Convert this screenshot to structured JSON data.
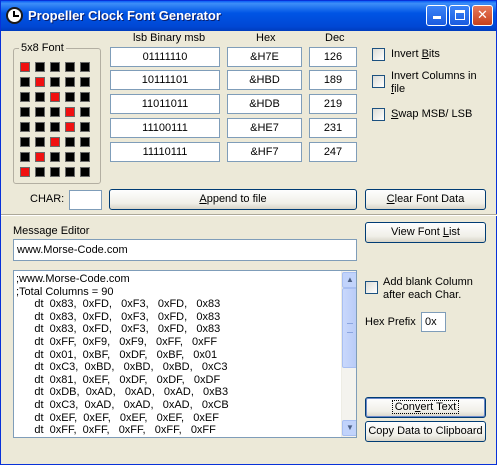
{
  "window": {
    "title": "Propeller Clock Font Generator",
    "accent": "#0055e5"
  },
  "font_editor": {
    "group_label": "5x8 Font",
    "grid": [
      [
        1,
        0,
        0,
        0,
        0
      ],
      [
        0,
        1,
        0,
        0,
        0
      ],
      [
        0,
        0,
        1,
        0,
        0
      ],
      [
        0,
        0,
        0,
        1,
        0
      ],
      [
        0,
        0,
        0,
        1,
        0
      ],
      [
        0,
        0,
        1,
        0,
        0
      ],
      [
        0,
        1,
        0,
        0,
        0
      ],
      [
        1,
        0,
        0,
        0,
        0
      ]
    ],
    "on_color": "#f01010",
    "off_color": "#000000",
    "headers": {
      "binary": "lsb  Binary  msb",
      "hex": "Hex",
      "dec": "Dec"
    },
    "rows": [
      {
        "binary": "01111110",
        "hex": "&H7E",
        "dec": "126"
      },
      {
        "binary": "10111101",
        "hex": "&HBD",
        "dec": "189"
      },
      {
        "binary": "11011011",
        "hex": "&HDB",
        "dec": "219"
      },
      {
        "binary": "11100111",
        "hex": "&HE7",
        "dec": "231"
      },
      {
        "binary": "11110111",
        "hex": "&HF7",
        "dec": "247"
      }
    ],
    "options": {
      "invert_bits": {
        "label_pre": "Invert ",
        "label_ul": "B",
        "label_post": "its"
      },
      "invert_columns": {
        "label_pre": "Invert Columns in ",
        "label_ul": "f",
        "label_post": "ile"
      },
      "swap": {
        "label_pre": "",
        "label_ul": "S",
        "label_post": "wap MSB/ LSB"
      }
    },
    "char_label": "CHAR:",
    "char_value": "",
    "append_button": {
      "pre": "",
      "ul": "A",
      "post": "ppend to file"
    },
    "clear_button": {
      "pre": "",
      "ul": "C",
      "post": "lear Font Data"
    }
  },
  "message_editor": {
    "label": "Message Editor",
    "message_value": "www.Morse-Code.com",
    "view_font_list_button": {
      "pre": "View Font ",
      "ul": "L",
      "post": "ist"
    },
    "output_lines": [
      ";www.Morse-Code.com",
      ";Total Columns = 90",
      "      dt  0x83,  0xFD,   0xF3,   0xFD,   0x83",
      "      dt  0x83,  0xFD,   0xF3,   0xFD,   0x83",
      "      dt  0x83,  0xFD,   0xF3,   0xFD,   0x83",
      "      dt  0xFF,  0xF9,   0xF9,   0xFF,   0xFF",
      "      dt  0x01,  0xBF,   0xDF,   0xBF,   0x01",
      "      dt  0xC3,  0xBD,   0xBD,   0xBD,   0xC3",
      "      dt  0x81,  0xEF,   0xDF,   0xDF,   0xDF",
      "      dt  0xDB,  0xAD,   0xAD,   0xAD,   0xB3",
      "      dt  0xC3,  0xAD,   0xAD,   0xAD,   0xCB",
      "      dt  0xEF,  0xEF,   0xEF,   0xEF,   0xEF",
      "      dt  0xFF,  0xFF,   0xFF,   0xFF,   0xFF"
    ],
    "add_blank_column_label": "Add blank Column after each Char.",
    "hex_prefix_label": "Hex Prefix",
    "hex_prefix_value": "0x",
    "convert_button": {
      "pre": "Con",
      "ul": "v",
      "post": "ert Text"
    },
    "copy_button": {
      "pre": "Copy Data to Clipboard",
      "ul": "",
      "post": ""
    }
  }
}
